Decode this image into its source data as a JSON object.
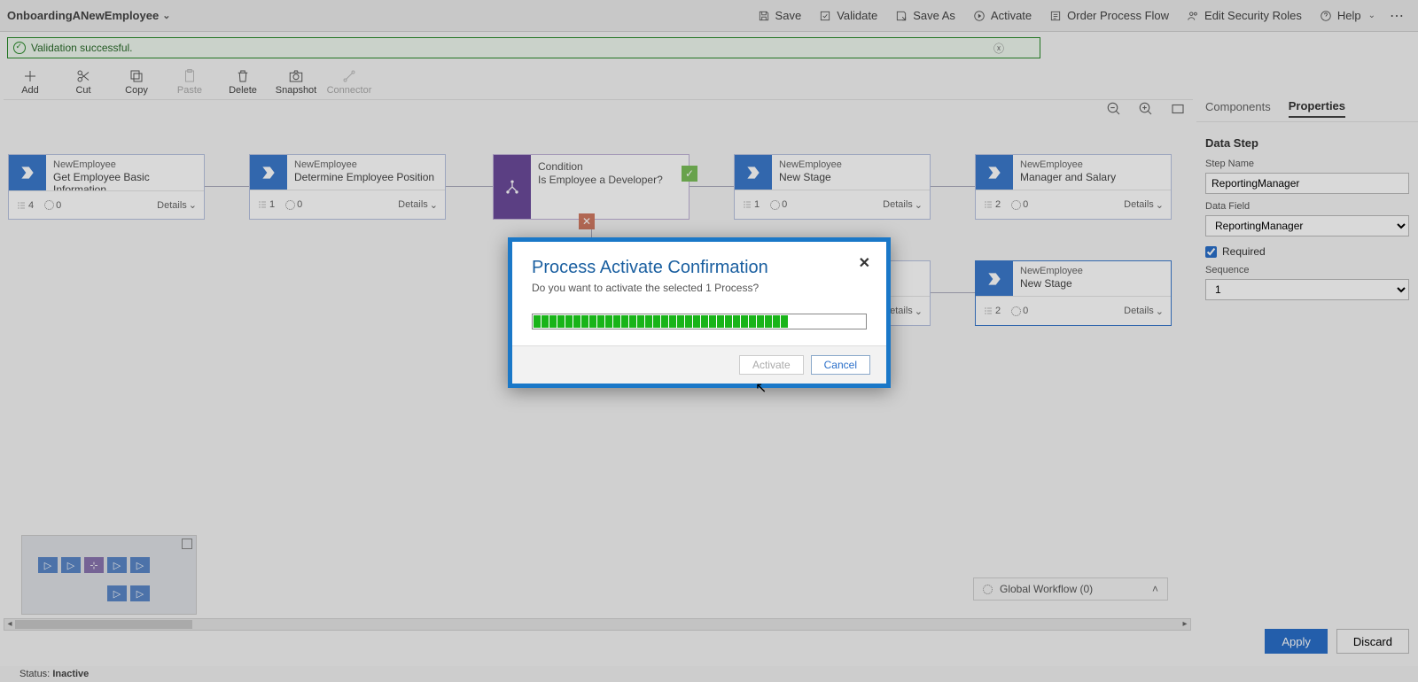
{
  "header": {
    "processName": "OnboardingANewEmployee",
    "buttons": {
      "save": "Save",
      "validate": "Validate",
      "saveAs": "Save As",
      "activate": "Activate",
      "orderProcessFlow": "Order Process Flow",
      "editSecurityRoles": "Edit Security Roles",
      "help": "Help"
    }
  },
  "validation": {
    "message": "Validation successful."
  },
  "editBar": {
    "add": "Add",
    "cut": "Cut",
    "copy": "Copy",
    "paste": "Paste",
    "delete": "Delete",
    "snapshot": "Snapshot",
    "connector": "Connector"
  },
  "stages": [
    {
      "entity": "NewEmployee",
      "name": "Get Employee Basic Information",
      "steps": "4",
      "flows": "0",
      "details": "Details"
    },
    {
      "entity": "NewEmployee",
      "name": "Determine Employee Position",
      "steps": "1",
      "flows": "0",
      "details": "Details"
    },
    {
      "entity": "Condition",
      "name": "Is Employee a Developer?",
      "kind": "condition"
    },
    {
      "entity": "NewEmployee",
      "name": "New Stage",
      "steps": "1",
      "flows": "0",
      "details": "Details"
    },
    {
      "entity": "NewEmployee",
      "name": "Manager and Salary",
      "steps": "2",
      "flows": "0",
      "details": "Details"
    },
    {
      "entity": "NewEmployee",
      "name": "New Stage",
      "steps": "2",
      "flows": "0",
      "details": "Details",
      "selected": true
    },
    {
      "hidden_partial": true,
      "details": "Details"
    }
  ],
  "globalWorkflow": {
    "label": "Global Workflow (0)"
  },
  "status": {
    "label": "Status:",
    "value": "Inactive"
  },
  "rightTabs": {
    "components": "Components",
    "properties": "Properties"
  },
  "dataStep": {
    "heading": "Data Step",
    "stepNameLabel": "Step Name",
    "stepNameValue": "ReportingManager",
    "dataFieldLabel": "Data Field",
    "dataFieldValue": "ReportingManager",
    "requiredLabel": "Required",
    "requiredChecked": true,
    "sequenceLabel": "Sequence",
    "sequenceValue": "1"
  },
  "propsActions": {
    "apply": "Apply",
    "discard": "Discard"
  },
  "modal": {
    "title": "Process Activate Confirmation",
    "body": "Do you want to activate the selected 1 Process?",
    "activate": "Activate",
    "cancel": "Cancel",
    "progressSegments": 32
  }
}
